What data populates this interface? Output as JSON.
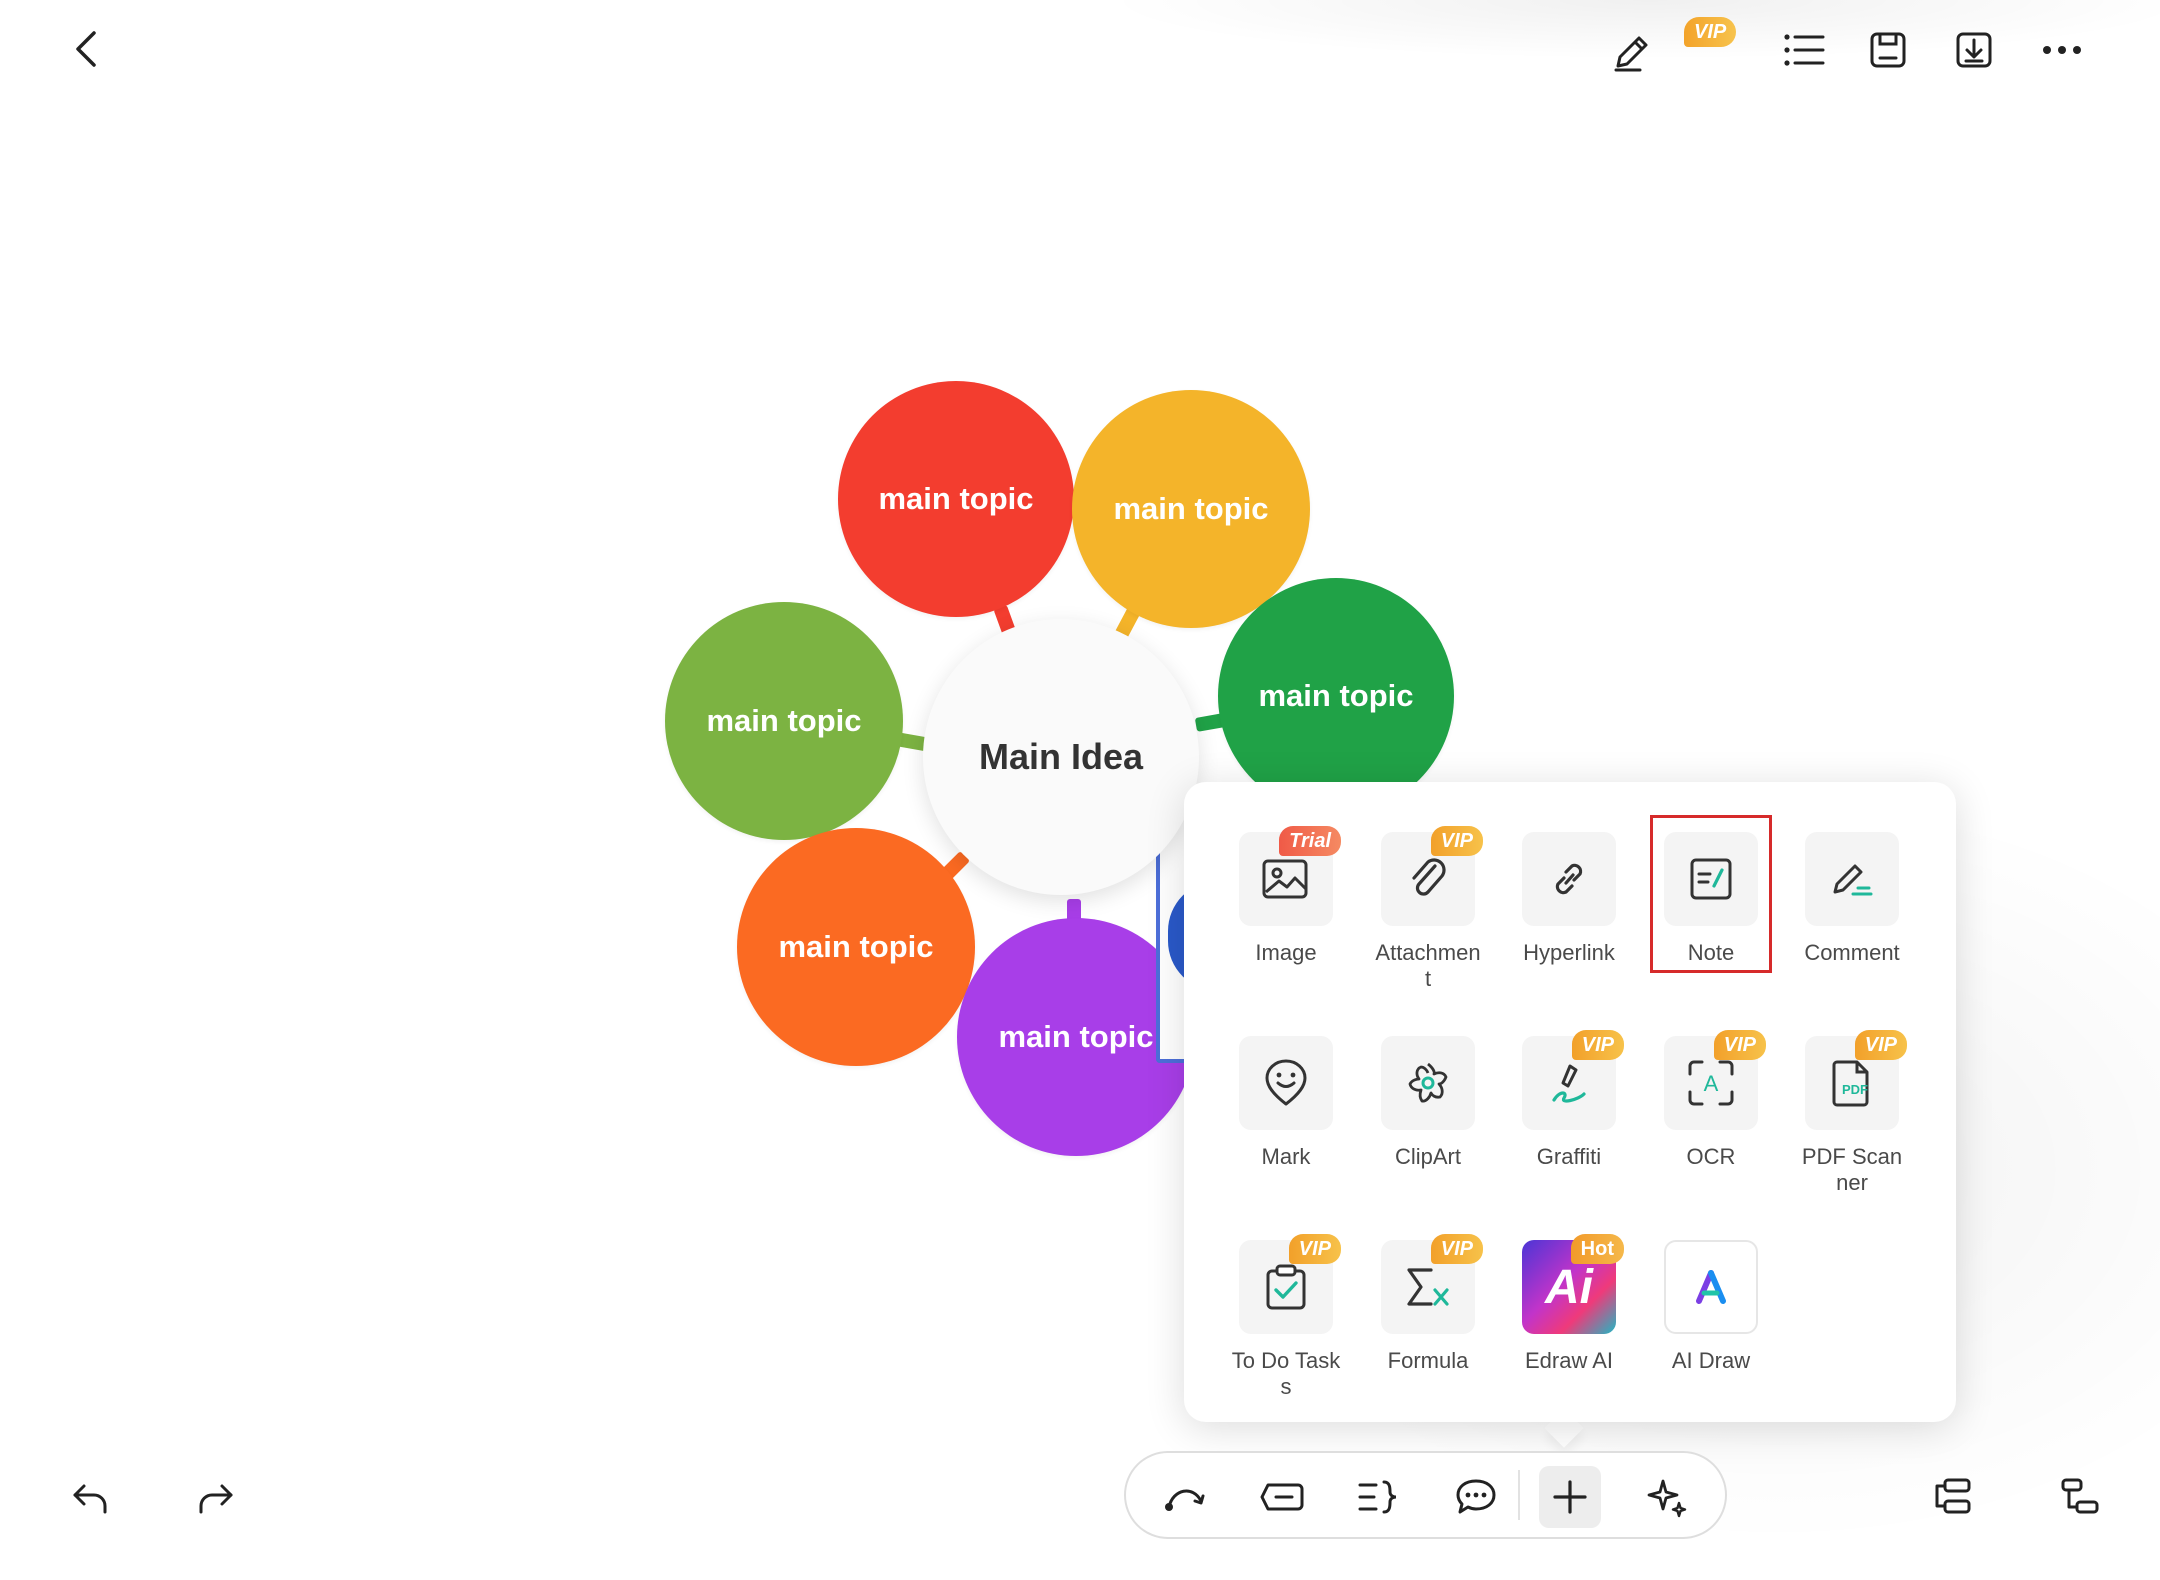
{
  "topbar": {
    "back_icon": "chevron-left-icon",
    "pen_icon": "pen-icon",
    "vip_label": "VIP",
    "outline_icon": "list-icon",
    "save_icon": "save-icon",
    "export_icon": "download-icon",
    "more_icon": "more-icon"
  },
  "mindmap": {
    "main_idea": "Main Idea",
    "topics": [
      {
        "label": "main topic",
        "color": "#f33d2f"
      },
      {
        "label": "main topic",
        "color": "#f4b42a"
      },
      {
        "label": "main topic",
        "color": "#20a247"
      },
      {
        "label": "main topic",
        "color": "#7cb342"
      },
      {
        "label": "main topic",
        "color": "#fb6a22"
      },
      {
        "label": "main topic",
        "color": "#a83ee8"
      }
    ]
  },
  "popup": {
    "items": [
      {
        "label": "Image",
        "tag": "Trial",
        "icon": "image-icon"
      },
      {
        "label": "Attachment",
        "tag": "VIP",
        "icon": "paperclip-icon"
      },
      {
        "label": "Hyperlink",
        "tag": "",
        "icon": "link-icon"
      },
      {
        "label": "Note",
        "tag": "",
        "icon": "note-icon"
      },
      {
        "label": "Comment",
        "tag": "",
        "icon": "comment-pen-icon"
      },
      {
        "label": "Mark",
        "tag": "",
        "icon": "smile-marker-icon"
      },
      {
        "label": "ClipArt",
        "tag": "",
        "icon": "flower-icon"
      },
      {
        "label": "Graffiti",
        "tag": "VIP",
        "icon": "brush-icon"
      },
      {
        "label": "OCR",
        "tag": "VIP",
        "icon": "ocr-scan-icon"
      },
      {
        "label": "PDF Scanner",
        "tag": "VIP",
        "icon": "pdf-icon"
      },
      {
        "label": "To Do Tasks",
        "tag": "VIP",
        "icon": "todo-clipboard-icon"
      },
      {
        "label": "Formula",
        "tag": "VIP",
        "icon": "sigma-icon"
      },
      {
        "label": "Edraw AI",
        "tag": "Hot",
        "icon": "edraw-ai-logo"
      },
      {
        "label": "AI Draw",
        "tag": "",
        "icon": "ai-draw-logo"
      }
    ],
    "ai_logo_text": "Ai",
    "pdf_icon_text": "PDF",
    "ocr_icon_text": "A",
    "selected_item": "Note"
  },
  "bottombar": {
    "undo_icon": "undo-icon",
    "redo_icon": "redo-icon",
    "relationship_icon": "relationship-curve-icon",
    "topic_icon": "topic-box-icon",
    "summary_icon": "summary-brace-icon",
    "callout_icon": "callout-bubble-icon",
    "insert_icon": "plus-icon",
    "ai_icon": "sparkle-icon",
    "layout_icon": "layout-icon",
    "structure_icon": "structure-icon"
  },
  "colors": {
    "accent_vip": "#f3a32a",
    "trial": "#f05a47",
    "highlight": "#d62a2a",
    "teal": "#1fb89a"
  }
}
